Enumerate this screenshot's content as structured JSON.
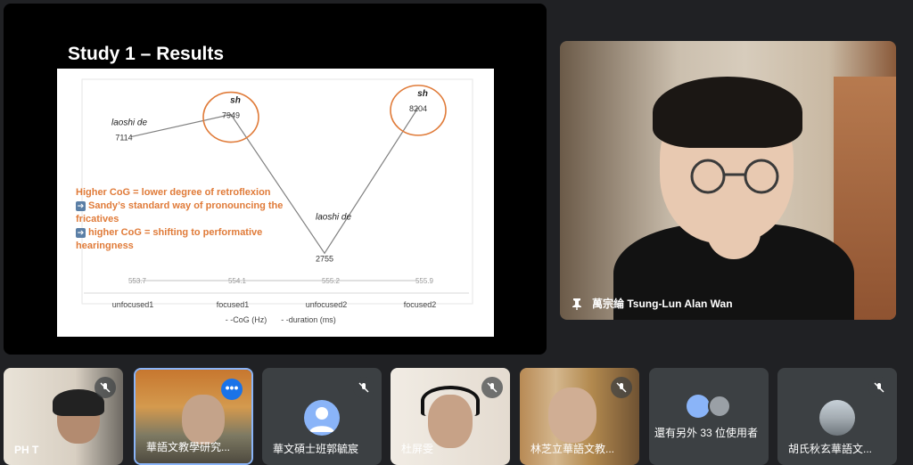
{
  "slide": {
    "title": "Study 1 – Results",
    "note_lines": [
      "Higher CoG = lower degree of retroflexion",
      "Sandy’s standard way of pronouncing the fricatives",
      "higher CoG = shifting to performative hearingness"
    ]
  },
  "chart_data": {
    "type": "line",
    "categories": [
      "unfocused1",
      "focused1",
      "unfocused2",
      "focused2"
    ],
    "series": [
      {
        "name": "CoG (Hz)",
        "values": [
          7114,
          7949,
          2755,
          8204
        ],
        "color": "#808080"
      },
      {
        "name": "duration (ms)",
        "values": [
          553.7,
          554.1,
          555.2,
          555.9
        ],
        "color": "#C0C0C0"
      }
    ],
    "point_labels": [
      "laoshi de",
      "sh",
      "laoshi de",
      "sh"
    ],
    "highlighted": [
      1,
      3
    ],
    "highlight_color": "#E07B39",
    "legend": [
      "- -CoG (Hz)",
      "- -duration (ms)"
    ]
  },
  "speaker": {
    "name": "萬宗綸 Tsung-Lun Alan Wan"
  },
  "tiles": [
    {
      "label": "PH T",
      "muted": true
    },
    {
      "label": "華語文教學研究...",
      "muted": false
    },
    {
      "label": "華文碩士班郭毓宸",
      "muted": true
    },
    {
      "label": "杜屏雯",
      "muted": true
    },
    {
      "label": "林芝立華語文教...",
      "muted": true
    },
    {
      "label": "還有另外 33 位使用者",
      "muted": false
    },
    {
      "label": "胡氏秋玄華語文...",
      "muted": true
    }
  ],
  "colors": {
    "accent": "#8ab4f8",
    "tile": "#3c4043",
    "bg": "#202124"
  }
}
